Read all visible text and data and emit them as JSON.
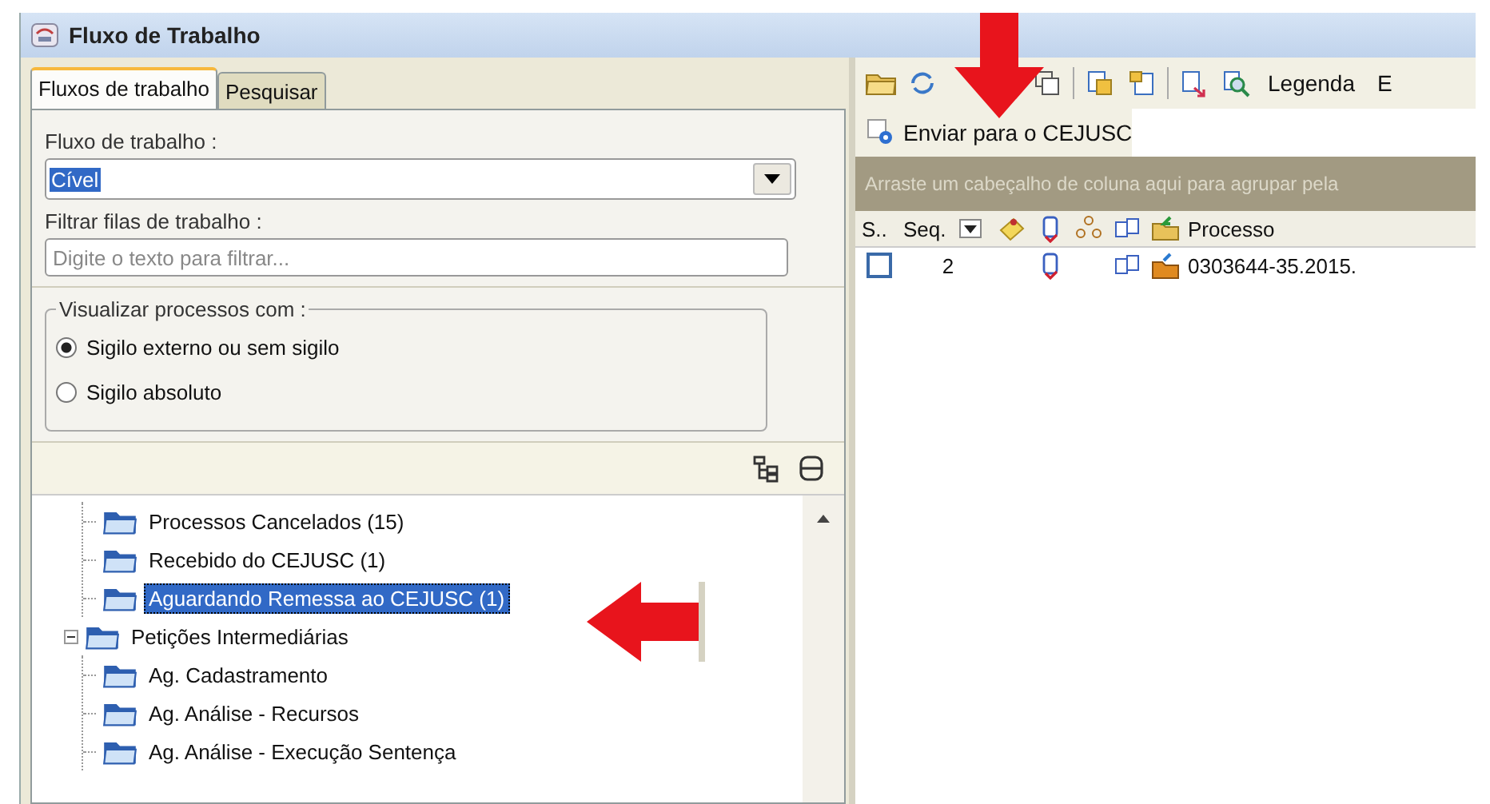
{
  "window": {
    "title": "Fluxo de Trabalho"
  },
  "left_panel": {
    "tabs": [
      {
        "label": "Fluxos de trabalho",
        "selected": true
      },
      {
        "label": "Pesquisar",
        "selected": false
      }
    ],
    "workflow": {
      "label": "Fluxo de trabalho :",
      "value": "Cível"
    },
    "filter": {
      "label": "Filtrar filas de trabalho :",
      "placeholder": "Digite o texto para filtrar..."
    },
    "visibility": {
      "legend": "Visualizar processos com :",
      "options": [
        {
          "label": "Sigilo externo ou sem sigilo",
          "selected": true
        },
        {
          "label": "Sigilo absoluto",
          "selected": false
        }
      ]
    },
    "tree": {
      "continued_children": [
        {
          "label": "Processos Cancelados (15)",
          "selected": false
        },
        {
          "label": "Recebido do CEJUSC (1)",
          "selected": false
        },
        {
          "label": "Aguardando Remessa ao CEJUSC (1)",
          "selected": true
        }
      ],
      "groups": [
        {
          "label": "Petições Intermediárias",
          "expanded": true,
          "selected": false,
          "children": [
            {
              "label": "Ag. Cadastramento",
              "selected": false
            },
            {
              "label": "Ag. Análise - Recursos",
              "selected": false
            },
            {
              "label": "Ag. Análise - Execução Sentença",
              "selected": false
            }
          ]
        }
      ]
    }
  },
  "right_panel": {
    "toolbar": {
      "legend": "Legenda",
      "cut_label": "E"
    },
    "action": "Enviar para o CEJUSC",
    "group_hint": "Arraste um cabeçalho de coluna aqui para agrupar pela",
    "grid": {
      "columns": {
        "select": "S..",
        "seq": "Seq.",
        "process": "Processo"
      },
      "rows": [
        {
          "checked": false,
          "seq": "2",
          "process": "0303644-35.2015."
        }
      ]
    }
  }
}
